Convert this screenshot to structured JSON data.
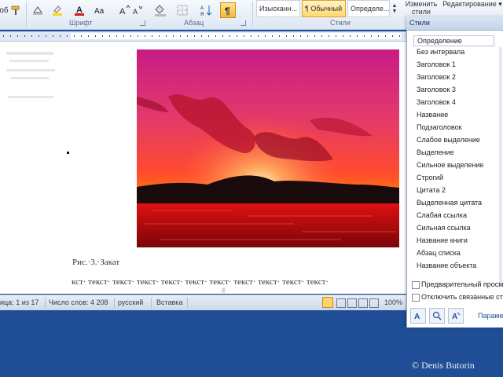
{
  "ribbon": {
    "group_font_label": "Шрифт",
    "group_paragraph_label": "Абзац",
    "group_styles_label": "Стили",
    "cut_label": "об",
    "styles_gallery": [
      {
        "label": "Изысканн...",
        "active": false
      },
      {
        "label": "¶ Обычный",
        "active": true
      },
      {
        "label": "Определе...",
        "active": false
      }
    ],
    "change_styles_label": "Изменить стили",
    "editing_label": "Редактирование",
    "font_color": "#d11c1c",
    "highlight_color": "#ffd800"
  },
  "document": {
    "caption": "Рис.·3.·Закат",
    "body_line": "кст·  текст·  текст·  текст·  текст·  текст·  текст·  текст·  текст·  текст·  текст·"
  },
  "status": {
    "page": "ица: 1 из 17",
    "words": "Число слов: 4 208",
    "language": "русский",
    "mode": "Вставка",
    "zoom": "100%"
  },
  "styles_pane": {
    "title": "Стили",
    "items": [
      "Определение",
      "Без интервала",
      "Заголовок 1",
      "Заголовок 2",
      "Заголовок 3",
      "Заголовок 4",
      "Название",
      "Подзаголовок",
      "Слабое выделение",
      "Выделение",
      "Сильное выделение",
      "Строгий",
      "Цитата 2",
      "Выделенная цитата",
      "Слабая ссылка",
      "Сильная ссылка",
      "Название книги",
      "Абзац списка",
      "Название объекта"
    ],
    "preview_label": "Предварительный просм",
    "disable_linked_label": "Отключить связанные ст",
    "options_label": "Парамет"
  },
  "desktop": {
    "copyright": "© Denis Butorin"
  }
}
